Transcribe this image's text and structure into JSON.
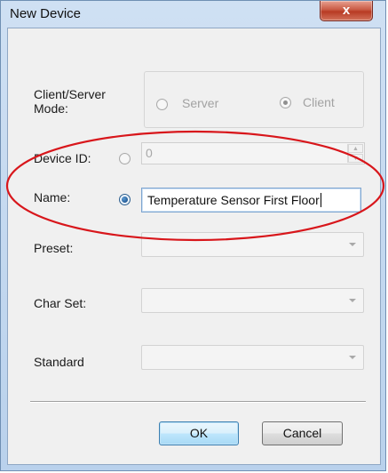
{
  "window": {
    "title": "New Device",
    "close_glyph": "x"
  },
  "form": {
    "mode_label": "Client/Server Mode:",
    "mode_options": [
      {
        "label": "Server",
        "selected": false,
        "enabled": false
      },
      {
        "label": "Client",
        "selected": true,
        "enabled": false
      }
    ],
    "device_id_label": "Device ID:",
    "device_id_value": "0",
    "name_label": "Name:",
    "name_value": "Temperature Sensor First Floor",
    "preset_label": "Preset:",
    "preset_value": "",
    "charset_label": "Char Set:",
    "charset_value": "",
    "standard_label": "Standard",
    "standard_value": ""
  },
  "buttons": {
    "ok_label": "OK",
    "cancel_label": "Cancel"
  },
  "annotation": {
    "color": "#d8161b",
    "shape": "ellipse"
  },
  "icons": [
    "close-icon",
    "spin-up-icon",
    "spin-down-icon",
    "dropdown-arrow-icon"
  ]
}
